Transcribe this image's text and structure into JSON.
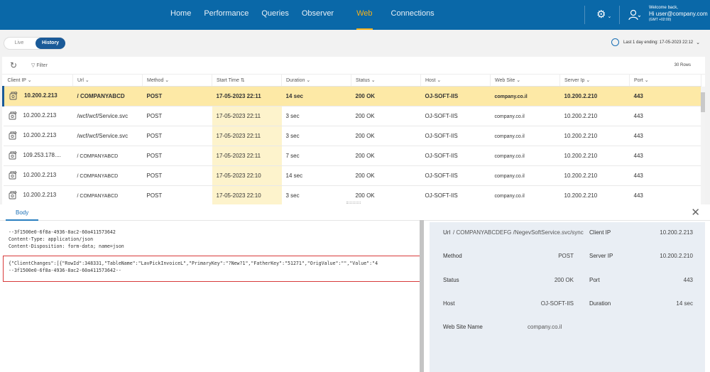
{
  "nav": {
    "items": [
      "Home",
      "Performance",
      "Queries",
      "Observer",
      "Web",
      "Connections"
    ],
    "active": "Web"
  },
  "user": {
    "welcome": "Welcome back,",
    "greeting": "Hi user@company.com",
    "tz": "(GMT +02:00)"
  },
  "mode": {
    "live": "Live",
    "history": "History"
  },
  "range": {
    "label": "Last 1 day ending: 17-05-2023 22:12"
  },
  "toolbar": {
    "filter": "Filter",
    "rows": "30 Rows"
  },
  "table": {
    "columns": [
      "Client IP",
      "Url",
      "Method",
      "Start Time",
      "Duration",
      "Status",
      "Host",
      "Web Site",
      "Server Ip",
      "Port"
    ],
    "rows": [
      [
        "10.200.2.213",
        "/ COMPANYABCD",
        "POST",
        "17-05-2023 22:11",
        "14 sec",
        "200 OK",
        "OJ-SOFT-IIS",
        "company.co.il",
        "10.200.2.210",
        "443"
      ],
      [
        "10.200.2.213",
        "/wcf/wcf/Service.svc",
        "POST",
        "17-05-2023 22:11",
        "3 sec",
        "200 OK",
        "OJ-SOFT-IIS",
        "company.co.il",
        "10.200.2.210",
        "443"
      ],
      [
        "10.200.2.213",
        "/wcf/wcf/Service.svc",
        "POST",
        "17-05-2023 22:11",
        "3 sec",
        "200 OK",
        "OJ-SOFT-IIS",
        "company.co.il",
        "10.200.2.210",
        "443"
      ],
      [
        "109.253.178....",
        "/ COMPANYABCD",
        "POST",
        "17-05-2023 22:11",
        "7 sec",
        "200 OK",
        "OJ-SOFT-IIS",
        "company.co.il",
        "10.200.2.210",
        "443"
      ],
      [
        "10.200.2.213",
        "/ COMPANYABCD",
        "POST",
        "17-05-2023 22:10",
        "14 sec",
        "200 OK",
        "OJ-SOFT-IIS",
        "company.co.il",
        "10.200.2.210",
        "443"
      ],
      [
        "10.200.2.213",
        "/ COMPANYABCD",
        "POST",
        "17-05-2023 22:10",
        "3 sec",
        "200 OK",
        "OJ-SOFT-IIS",
        "company.co.il",
        "10.200.2.210",
        "443"
      ]
    ]
  },
  "body": {
    "tab": "Body",
    "lines": [
      "--3f1500e0-6f8a-4936-8ac2-60a411573642",
      "Content-Type: application/json",
      "Content-Disposition: form-data; name=json"
    ],
    "highlight_lines": [
      "{\"ClientChanges\":[{\"RowId\":348331,\"TableName\":\"LavPickInvoiceL\",\"PrimaryKey\":\"?New?1\",\"FatherKey\":\"51271\",\"OrigValue\":\"\",\"Value\":\"4",
      "--3f1500e0-6f8a-4936-8ac2-60a411573642--"
    ]
  },
  "details": {
    "url_label": "Url",
    "url_value": "/ COMPANYABCDEFG /NegevSoftService.svc/sync",
    "client_ip_label": "Client IP",
    "client_ip_value": "10.200.2.213",
    "method_label": "Method",
    "method_value": "POST",
    "server_ip_label": "Server IP",
    "server_ip_value": "10.200.2.210",
    "status_label": "Status",
    "status_value": "200 OK",
    "port_label": "Port",
    "port_value": "443",
    "host_label": "Host",
    "host_value": "OJ-SOFT-IIS",
    "duration_label": "Duration",
    "duration_value": "14 sec",
    "website_label": "Web Site Name",
    "website_value": "company.co.il"
  },
  "colors": {
    "header": "#0a68a8",
    "active_nav": "#f5b21c",
    "selected_row": "#fde9a6",
    "highlight_border": "#d83a3a"
  },
  "icons": [
    "gear-icon",
    "user-icon",
    "clock-icon",
    "refresh-icon",
    "filter-icon",
    "request-icon",
    "close-icon"
  ]
}
